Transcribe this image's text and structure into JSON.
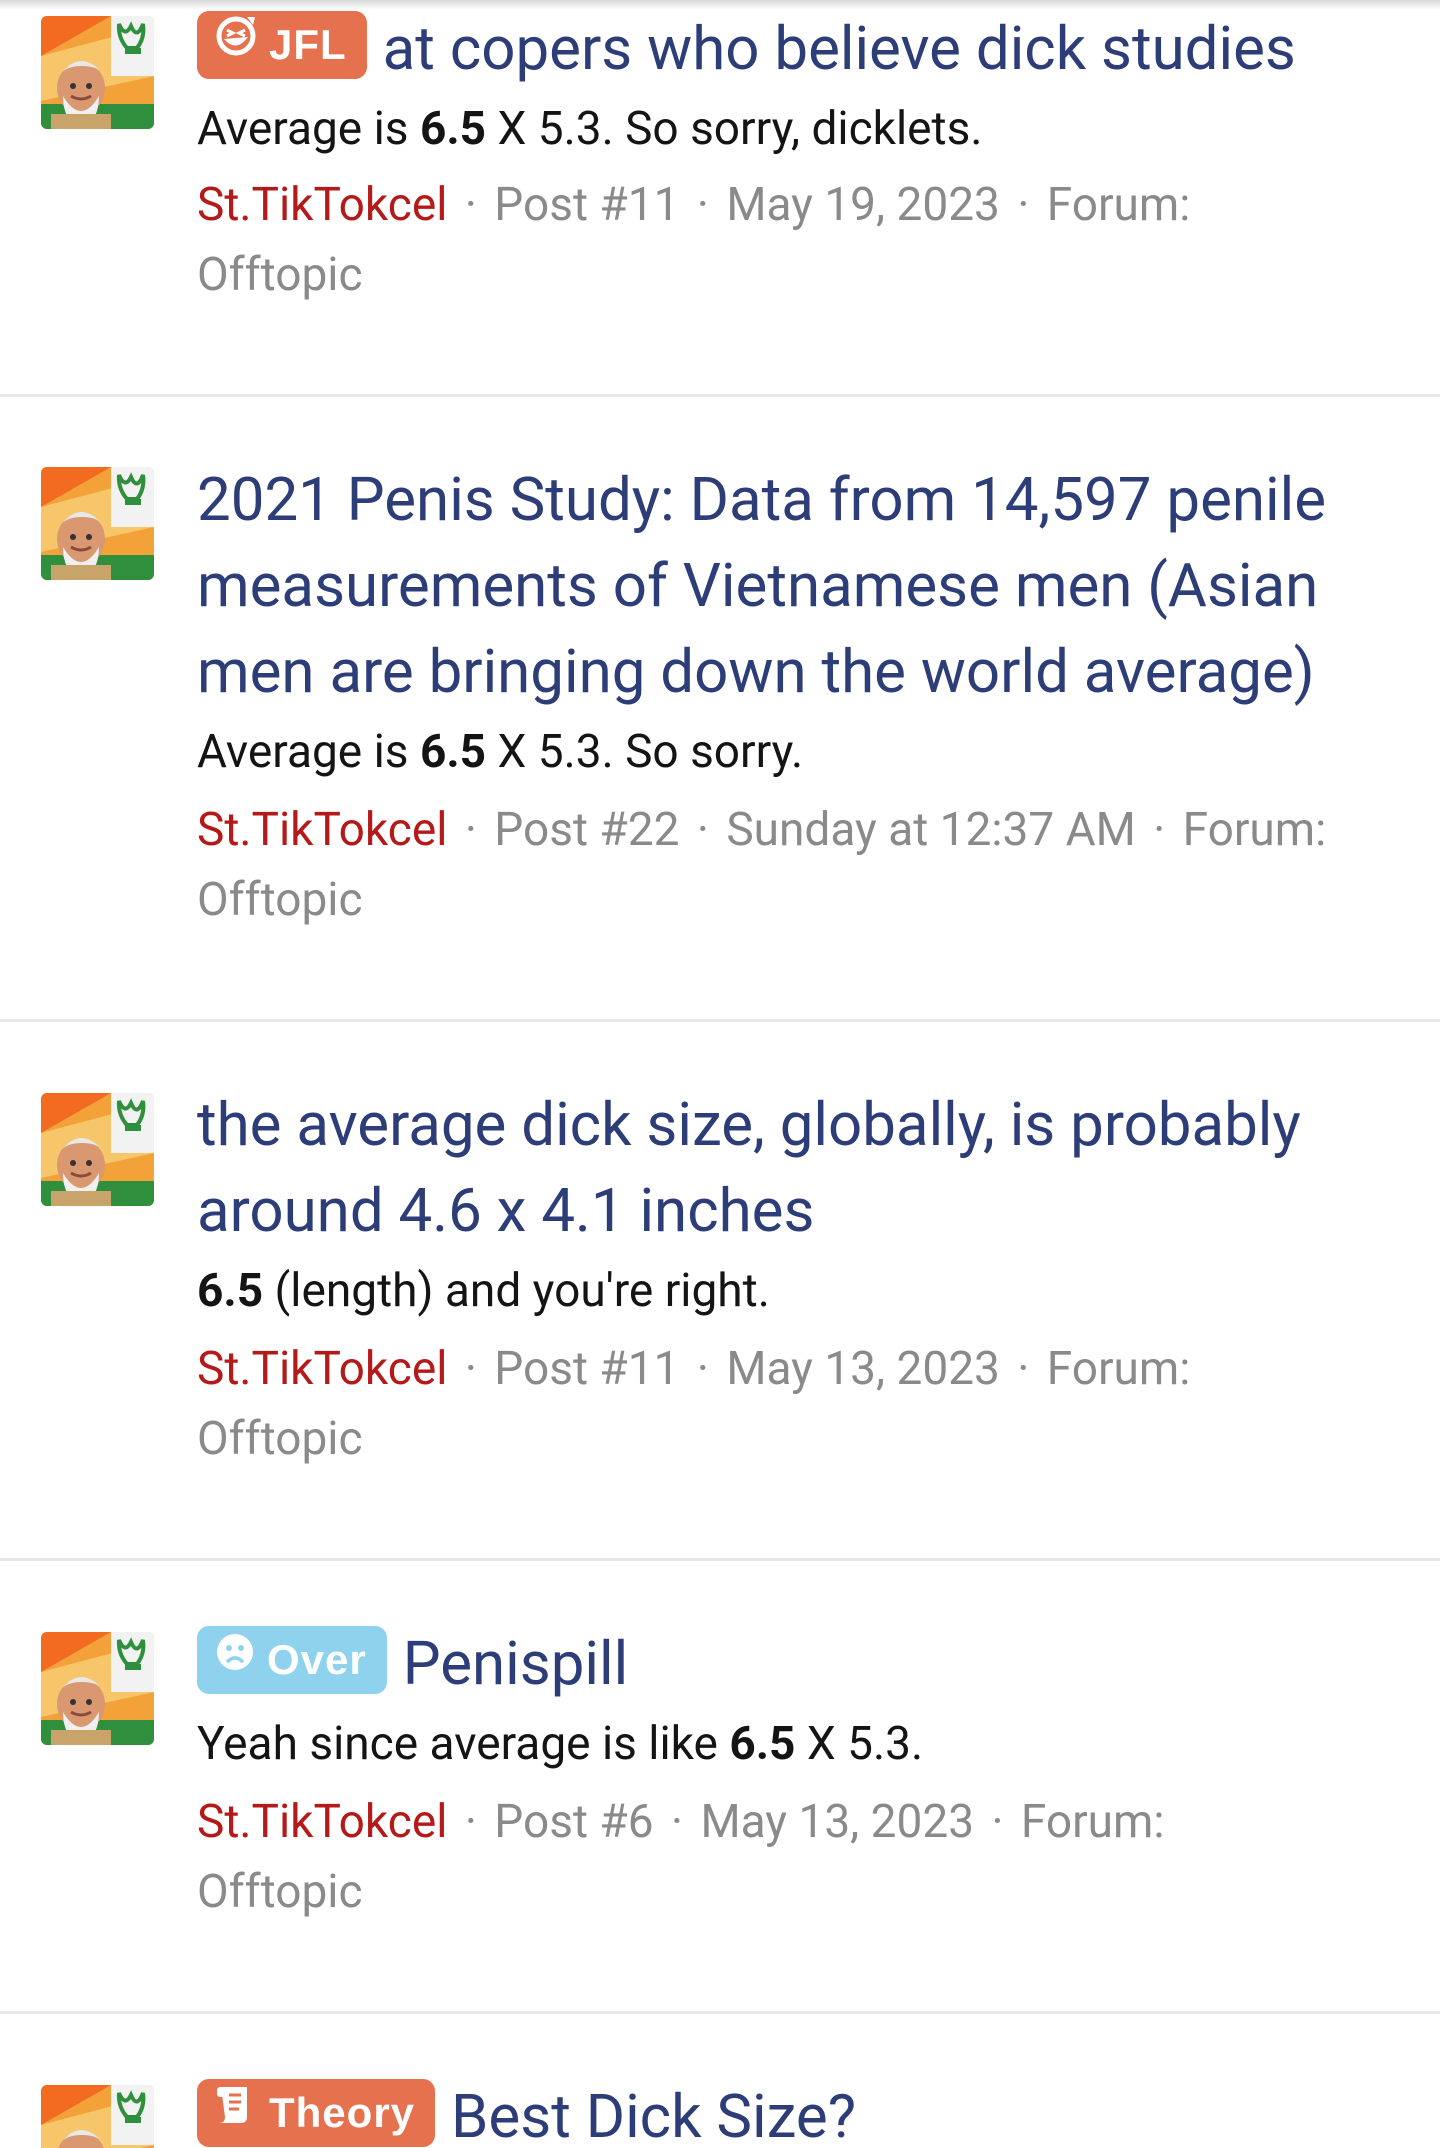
{
  "results": [
    {
      "badge": {
        "label": "JFL",
        "color": "#e6714e",
        "icon": "laugh-icon"
      },
      "title_lines": [
        "at copers who believe dick studies"
      ],
      "snippet": {
        "before": "Average is ",
        "bold": "6.5",
        "after": " X 5.3. So sorry, dicklets."
      },
      "author": "St.TikTokcel",
      "post": "Post #11",
      "date": "May 19, 2023",
      "forum_label": "Forum:",
      "forum": "Offtopic"
    },
    {
      "badge": null,
      "title_lines": [
        "2021 Penis Study: Data from 14,597 penile",
        "measurements of Vietnamese men (Asian",
        "men are bringing down the world average)"
      ],
      "snippet": {
        "before": "Average is ",
        "bold": "6.5",
        "after": " X 5.3. So sorry."
      },
      "author": "St.TikTokcel",
      "post": "Post #22",
      "date": "Sunday at 12:37 AM",
      "forum_label": "Forum:",
      "forum": "Offtopic"
    },
    {
      "badge": null,
      "title_lines": [
        "the average dick size, globally, is probably",
        "around 4.6 x 4.1 inches"
      ],
      "snippet": {
        "before": "",
        "bold": "6.5",
        "after": " (length) and you're right."
      },
      "author": "St.TikTokcel",
      "post": "Post #11",
      "date": "May 13, 2023",
      "forum_label": "Forum:",
      "forum": "Offtopic"
    },
    {
      "badge": {
        "label": "Over",
        "color": "#8fd2ee",
        "icon": "sad-face-icon"
      },
      "title_lines": [
        "Penispill"
      ],
      "snippet": {
        "before": "Yeah since average is like ",
        "bold": "6.5",
        "after": " X 5.3."
      },
      "author": "St.TikTokcel",
      "post": "Post #6",
      "date": "May 13, 2023",
      "forum_label": "Forum:",
      "forum": "Offtopic"
    },
    {
      "badge": {
        "label": "Theory",
        "color": "#e6714e",
        "icon": "scroll-icon"
      },
      "title_lines": [
        "Best Dick Size?"
      ]
    }
  ]
}
